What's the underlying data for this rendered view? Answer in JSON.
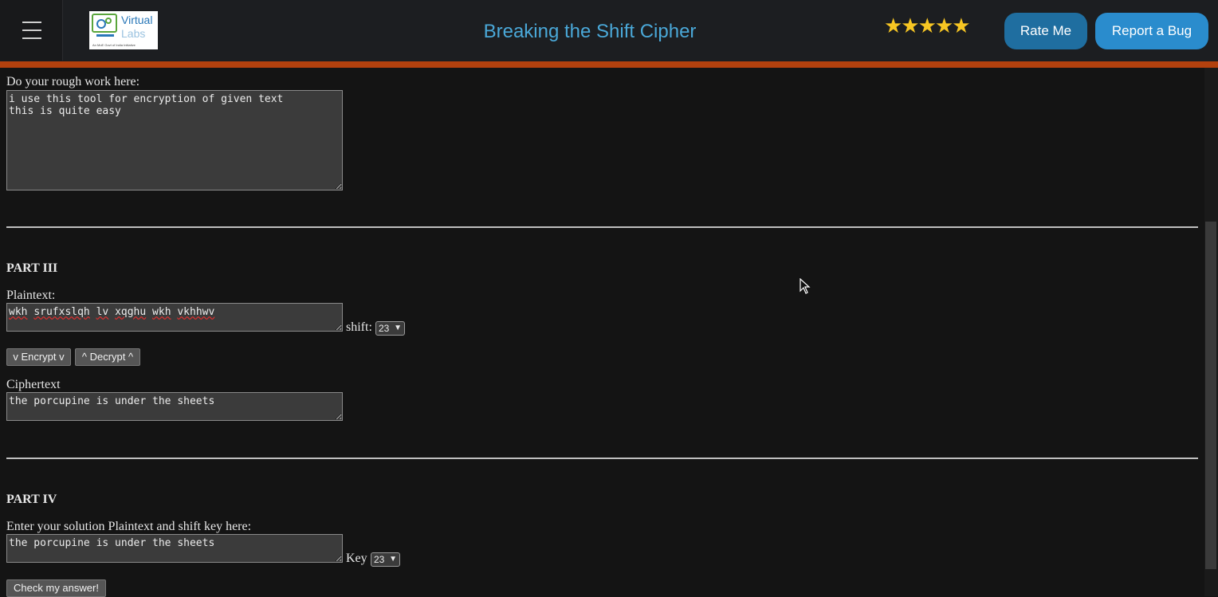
{
  "header": {
    "title": "Breaking the Shift Cipher",
    "logo": {
      "line1": "Virtual",
      "line2": "Labs",
      "tagline": "An MoE Govt of India Initiative"
    },
    "stars": "★★★★★",
    "rate_label": "Rate Me",
    "bug_label": "Report a Bug"
  },
  "rough": {
    "label": "Do your rough work here:",
    "text": "i use this tool for encryption of given text\nthis is quite easy"
  },
  "part3": {
    "heading": "PART III",
    "plaintext_label": "Plaintext:",
    "plaintext_words": [
      "wkh",
      "srufxslqh",
      "lv",
      "xqghu",
      "wkh",
      "vkhhwv"
    ],
    "shift_label": "shift:",
    "shift_value": "23",
    "encrypt_label": "v Encrypt v",
    "decrypt_label": "^ Decrypt ^",
    "ciphertext_label": "Ciphertext",
    "ciphertext_value": "the porcupine is under the sheets"
  },
  "part4": {
    "heading": "PART IV",
    "prompt": "Enter your solution Plaintext and shift key here:",
    "solution_value": "the porcupine is under the sheets",
    "key_label": "Key",
    "key_value": "23",
    "check_label": "Check my answer!"
  },
  "colors": {
    "header_bg": "#1c1e21",
    "accent_orange": "#b3410e",
    "title_blue": "#4aa8d8",
    "star_yellow": "#f7c623"
  }
}
